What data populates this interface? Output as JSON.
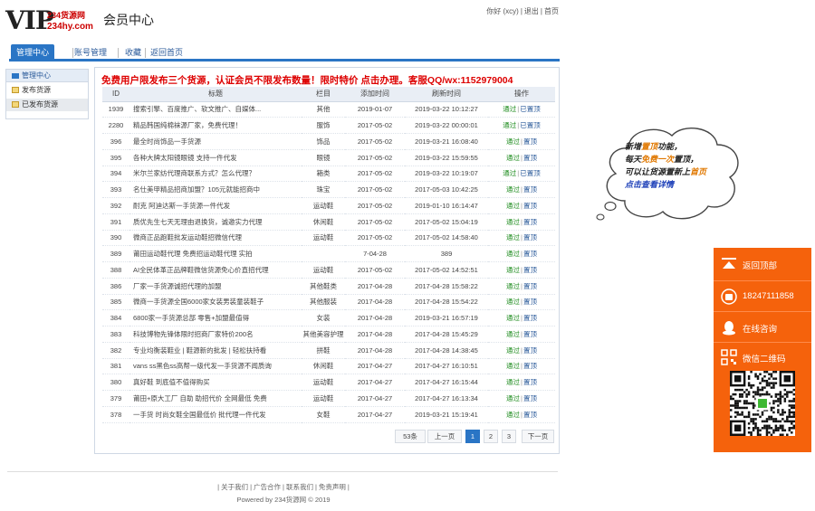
{
  "header": {
    "logo_text": "VIP",
    "logo_site_a": "234货源网",
    "logo_site_b": "234hy.com",
    "page_title": "会员中心",
    "user_greeting": "你好 (xcy)",
    "logout": "退出",
    "home": "首页"
  },
  "tabs": [
    {
      "label": "管理中心",
      "active": true
    },
    {
      "label": "账号管理",
      "active": false
    },
    {
      "label": "收藏",
      "active": false
    },
    {
      "label": "返回首页",
      "active": false
    }
  ],
  "sidemenu": {
    "title": "管理中心",
    "items": [
      {
        "label": "发布货源",
        "selected": false
      },
      {
        "label": "已发布货源",
        "selected": true
      }
    ]
  },
  "banner": "免费用户限发布三个货源，认证会员不限发布数量！限时特价 点击办理。客服QQ/wx:1152979004",
  "table": {
    "headers": [
      "ID",
      "标题",
      "栏目",
      "添加时间",
      "刷新时间",
      "操作"
    ],
    "rows": [
      {
        "id": "1939",
        "title": "搜索引擎、百度推广、软文推广、自媒体...",
        "cat": "其他",
        "added": "2019-01-07",
        "refreshed": "2019-03-22 10:12:27",
        "a1": "通过",
        "a2": "已置顶"
      },
      {
        "id": "2280",
        "title": "精品韩国纯棉袜源厂家，免费代理！",
        "cat": "服饰",
        "added": "2017-05-02",
        "refreshed": "2019-03-22 00:00:01",
        "a1": "通过",
        "a2": "已置顶"
      },
      {
        "id": "396",
        "title": "最全时尚饰品一手货源",
        "cat": "饰品",
        "added": "2017-05-02",
        "refreshed": "2019-03-21 16:08:40",
        "a1": "通过",
        "a2": "置顶"
      },
      {
        "id": "395",
        "title": "各种大牌太阳镜眼镜 支持一件代发",
        "cat": "眼镜",
        "added": "2017-05-02",
        "refreshed": "2019-03-22 15:59:55",
        "a1": "通过",
        "a2": "置顶"
      },
      {
        "id": "394",
        "title": "米尔兰家纺代理商联系方式？怎么代理？",
        "cat": "箱类",
        "added": "2017-05-02",
        "refreshed": "2019-03-22 10:19:07",
        "a1": "通过",
        "a2": "已置顶"
      },
      {
        "id": "393",
        "title": "名仕美甲精品招商加盟？105元就能招商中",
        "cat": "珠宝",
        "added": "2017-05-02",
        "refreshed": "2017-05-03 10:42:25",
        "a1": "通过",
        "a2": "置顶"
      },
      {
        "id": "392",
        "title": "耐克 阿迪达斯一手货源一件代发",
        "cat": "运动鞋",
        "added": "2017-05-02",
        "refreshed": "2019-01-10 16:14:47",
        "a1": "通过",
        "a2": "置顶"
      },
      {
        "id": "391",
        "title": "质优先生七天无理由退换货，诚邀实力代理",
        "cat": "休闲鞋",
        "added": "2017-05-02",
        "refreshed": "2017-05-02 15:04:19",
        "a1": "通过",
        "a2": "置顶"
      },
      {
        "id": "390",
        "title": "微商正品跑鞋批发运动鞋招微信代理",
        "cat": "运动鞋",
        "added": "2017-05-02",
        "refreshed": "2017-05-02 14:58:40",
        "a1": "通过",
        "a2": "置顶"
      },
      {
        "id": "389",
        "title": "莆田运动鞋代理 免费招运动鞋代理 实拍",
        "cat": "",
        "added": "7-04-28",
        "refreshed": "389",
        "a1": "通过",
        "a2": "置顶"
      },
      {
        "id": "388",
        "title": "AI全民体革正品牌鞋微信货源免心价直招代理",
        "cat": "运动鞋",
        "added": "2017-05-02",
        "refreshed": "2017-05-02 14:52:51",
        "a1": "通过",
        "a2": "置顶"
      },
      {
        "id": "386",
        "title": "厂家一手货源诚招代理的加盟",
        "cat": "其他鞋类",
        "added": "2017-04-28",
        "refreshed": "2017-04-28 15:58:22",
        "a1": "通过",
        "a2": "置顶"
      },
      {
        "id": "385",
        "title": "微商一手货源全国6000家女装男装童装鞋子",
        "cat": "其他服装",
        "added": "2017-04-28",
        "refreshed": "2017-04-28 15:54:22",
        "a1": "通过",
        "a2": "置顶"
      },
      {
        "id": "384",
        "title": "6800家一手货源总部 零售+加盟最值得",
        "cat": "女装",
        "added": "2017-04-28",
        "refreshed": "2019-03-21 16:57:19",
        "a1": "通过",
        "a2": "置顶"
      },
      {
        "id": "383",
        "title": "科技博物先锋体限时招商厂家特价200名",
        "cat": "其他美容护理",
        "added": "2017-04-28",
        "refreshed": "2017-04-28 15:45:29",
        "a1": "通过",
        "a2": "置顶"
      },
      {
        "id": "382",
        "title": "专业均衡装鞋业 | 鞋源新的批发 | 轻松扶持看",
        "cat": "拼鞋",
        "added": "2017-04-28",
        "refreshed": "2017-04-28 14:38:45",
        "a1": "通过",
        "a2": "置顶"
      },
      {
        "id": "381",
        "title": "vans ss黑色ss高帮一级代发一手货源不闻质询",
        "cat": "休闲鞋",
        "added": "2017-04-27",
        "refreshed": "2017-04-27 16:10:51",
        "a1": "通过",
        "a2": "置顶"
      },
      {
        "id": "380",
        "title": "真好鞋 到底值不值得购买",
        "cat": "运动鞋",
        "added": "2017-04-27",
        "refreshed": "2017-04-27 16:15:44",
        "a1": "通过",
        "a2": "置顶"
      },
      {
        "id": "379",
        "title": "莆田+原大工厂 自助 助招代价 全网最低 免费",
        "cat": "运动鞋",
        "added": "2017-04-27",
        "refreshed": "2017-04-27 16:13:34",
        "a1": "通过",
        "a2": "置顶"
      },
      {
        "id": "378",
        "title": "一手货 时尚女鞋全国最低价 批代理一件代发",
        "cat": "女鞋",
        "added": "2017-04-27",
        "refreshed": "2019-03-21 15:19:41",
        "a1": "通过",
        "a2": "置顶"
      }
    ]
  },
  "pager": {
    "total": "53条",
    "prev": "上一页",
    "pages": [
      "1",
      "2",
      "3"
    ],
    "current": "1",
    "next": "下一页"
  },
  "footer": {
    "links": [
      "关于我们",
      "广告合作",
      "联系我们",
      "免责声明"
    ],
    "powered": "Powered by 234货源网 © 2019"
  },
  "cloud": {
    "line1_a": "新增",
    "line1_hl": "置顶",
    "line1_b": "功能，",
    "line2_a": "每天",
    "line2_hl": "免费一次",
    "line2_b": "置顶，",
    "line3_a": "可以让货源置新上",
    "line3_hl": "首页",
    "line4": "点击查看详情"
  },
  "right_widget": {
    "back_top": "返回顶部",
    "phone": "18247111858",
    "online": "在线咨询",
    "wechat": "微信二维码"
  },
  "colors": {
    "accent_blue": "#2a75c5",
    "banner_red": "#dd0000",
    "pass_green": "#1a8a1a",
    "widget_orange": "#f5620c"
  }
}
